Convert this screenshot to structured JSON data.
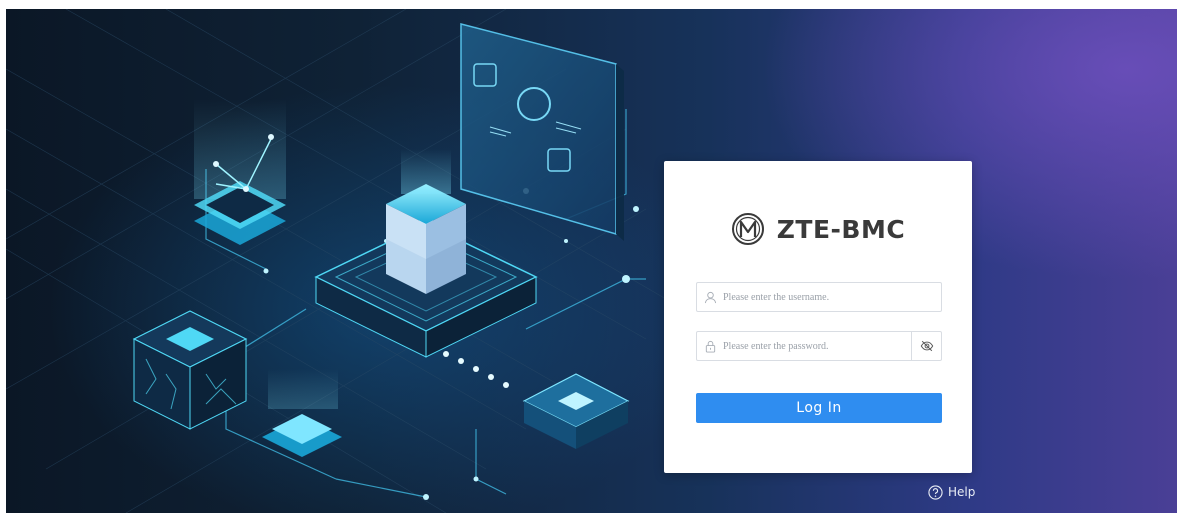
{
  "brand": {
    "name": "ZTE-BMC",
    "logo_icon": "circled-m-logo"
  },
  "login_form": {
    "username": {
      "placeholder": "Please enter the username.",
      "value": "",
      "icon": "user-icon"
    },
    "password": {
      "placeholder": "Please enter the password.",
      "value": "",
      "icon": "lock-icon",
      "toggle_icon": "eye-slash-icon"
    },
    "submit_label": "Log In"
  },
  "footer": {
    "help_label": "Help",
    "help_icon": "question-circle-icon"
  },
  "colors": {
    "primary_button": "#2f8df0",
    "brand_text": "#3a3a3a",
    "background_dark": "#0b1726",
    "background_purple": "#4a3f96",
    "accent_cyan": "#4fd8f5"
  }
}
